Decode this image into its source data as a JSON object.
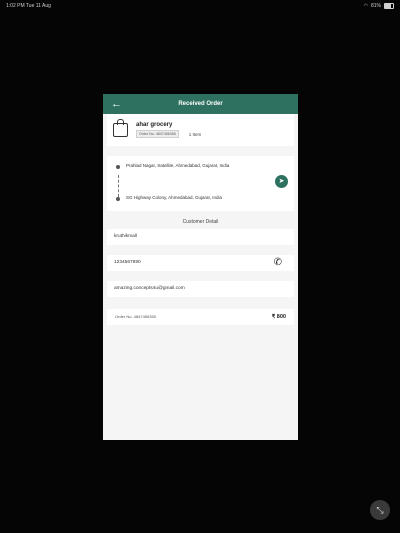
{
  "statusbar": {
    "time": "1:02 PM",
    "date": "Tue 11 Aug",
    "battery": "81%"
  },
  "dialog": {
    "title": "Received Order",
    "store": {
      "name": "ahar grocery",
      "order_tag": "Order No. 4847456355",
      "items": "1 Item"
    },
    "route": {
      "pickup": "Prahlad Nagar, Satellite, Ahmedabad, Gujarat, India",
      "drop": "SG Highway Colony, Ahmedabad, Gujarat, India"
    },
    "customer_section": "Customer Detail",
    "customer": {
      "name": "kruthikmall",
      "phone": "1234567890",
      "email": "amazing.concepts4u@gmail.com"
    },
    "order": {
      "label": "Order No.  4847456355",
      "amount": "₹ 800"
    }
  },
  "icons": {
    "back": "arrow-left-icon",
    "bag": "shopping-bag-icon",
    "navigate": "navigation-arrow-icon",
    "phone": "phone-icon",
    "fab": "fullscreen-exit-icon"
  },
  "colors": {
    "header": "#2f7160",
    "background": "#050505"
  }
}
